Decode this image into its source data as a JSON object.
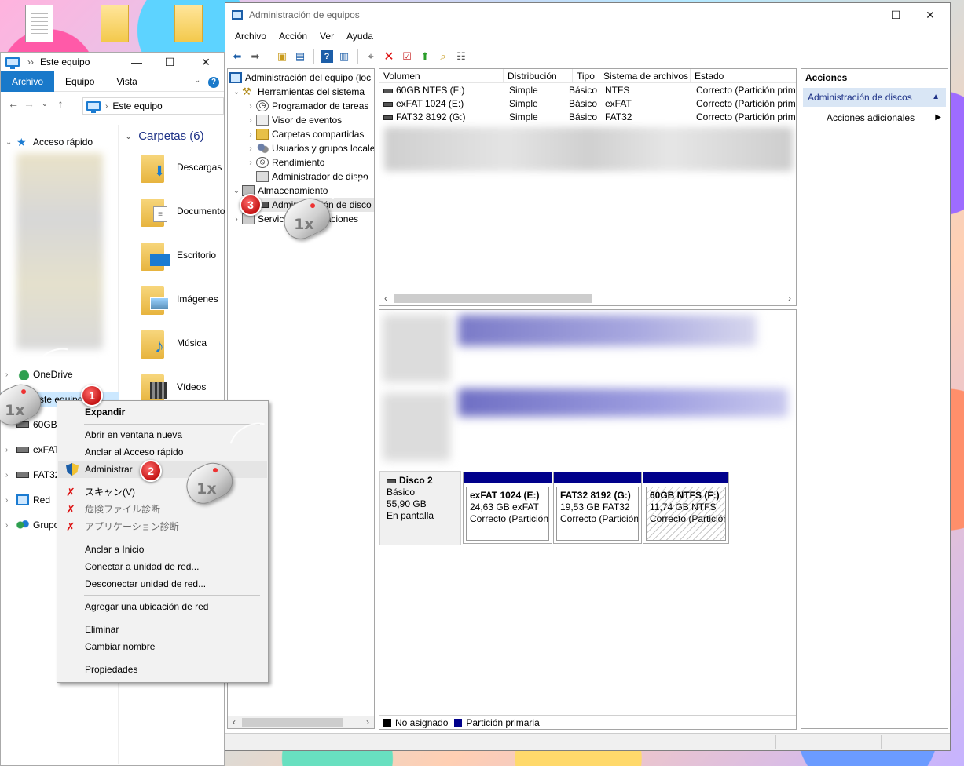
{
  "explorer": {
    "title": "Este equipo",
    "ribbon_tabs": [
      "Archivo",
      "Equipo",
      "Vista"
    ],
    "help_symbol": "?",
    "address_path": "Este equipo",
    "nav": {
      "quick_access": "Acceso rápido",
      "onedrive": "OneDrive",
      "this_pc": "Este equipo",
      "drive_60": "60GB",
      "drive_exfat": "exFAT",
      "drive_fat32": "FAT32",
      "network": "Red",
      "homegroup": "Grupo"
    },
    "folders_header": "Carpetas (6)",
    "folders": [
      "Descargas",
      "Documentos",
      "Escritorio",
      "Imágenes",
      "Música",
      "Vídeos"
    ]
  },
  "context_menu": {
    "expand": "Expandir",
    "open_new_window": "Abrir en ventana nueva",
    "pin_quick": "Anclar al Acceso rápido",
    "manage": "Administrar",
    "scan": "スキャン(V)",
    "danger_files": "危険ファイル診断",
    "app_diag": "アプリケーション診断",
    "pin_start": "Anclar a Inicio",
    "map_drive": "Conectar a unidad de red...",
    "disconnect_drive": "Desconectar unidad de red...",
    "add_network_location": "Agregar una ubicación de red",
    "delete": "Eliminar",
    "rename": "Cambiar nombre",
    "properties": "Propiedades"
  },
  "mmc": {
    "title": "Administración de equipos",
    "menu": [
      "Archivo",
      "Acción",
      "Ver",
      "Ayuda"
    ],
    "tree": {
      "root": "Administración del equipo (loc",
      "system_tools": "Herramientas del sistema",
      "task_scheduler": "Programador de tareas",
      "event_viewer": "Visor de eventos",
      "shared_folders": "Carpetas compartidas",
      "users_groups": "Usuarios y grupos locale",
      "performance": "Rendimiento",
      "device_manager": "Administrador de dispo",
      "storage": "Almacenamiento",
      "disk_management": "Administración de disco",
      "services": "Servicios y Aplicaciones"
    },
    "columns": [
      "Volumen",
      "Distribución",
      "Tipo",
      "Sistema de archivos",
      "Estado"
    ],
    "volumes": [
      {
        "name": "60GB NTFS (F:)",
        "layout": "Simple",
        "type": "Básico",
        "fs": "NTFS",
        "status": "Correcto (Partición prim"
      },
      {
        "name": "exFAT 1024 (E:)",
        "layout": "Simple",
        "type": "Básico",
        "fs": "exFAT",
        "status": "Correcto (Partición prim"
      },
      {
        "name": "FAT32 8192 (G:)",
        "layout": "Simple",
        "type": "Básico",
        "fs": "FAT32",
        "status": "Correcto (Partición prim"
      }
    ],
    "disk": {
      "name": "Disco 2",
      "kind": "Básico",
      "size": "55,90 GB",
      "state": "En pantalla"
    },
    "partitions": [
      {
        "label": "exFAT 1024  (E:)",
        "size": "24,63 GB exFAT",
        "status": "Correcto (Partición"
      },
      {
        "label": "FAT32 8192  (G:)",
        "size": "19,53 GB FAT32",
        "status": "Correcto (Partición"
      },
      {
        "label": "60GB NTFS  (F:)",
        "size": "11,74 GB NTFS",
        "status": "Correcto (Partición"
      }
    ],
    "legend": {
      "unallocated": "No asignado",
      "primary": "Partición primaria"
    },
    "actions": {
      "header": "Acciones",
      "section": "Administración de discos",
      "more": "Acciones adicionales"
    }
  },
  "steps": {
    "one": "1",
    "two": "2",
    "three": "3",
    "click": "1x"
  },
  "colors": {
    "ribbon_accent": "#1979ca",
    "partition_bar": "#00008b",
    "step_badge": "#d01a1a"
  }
}
